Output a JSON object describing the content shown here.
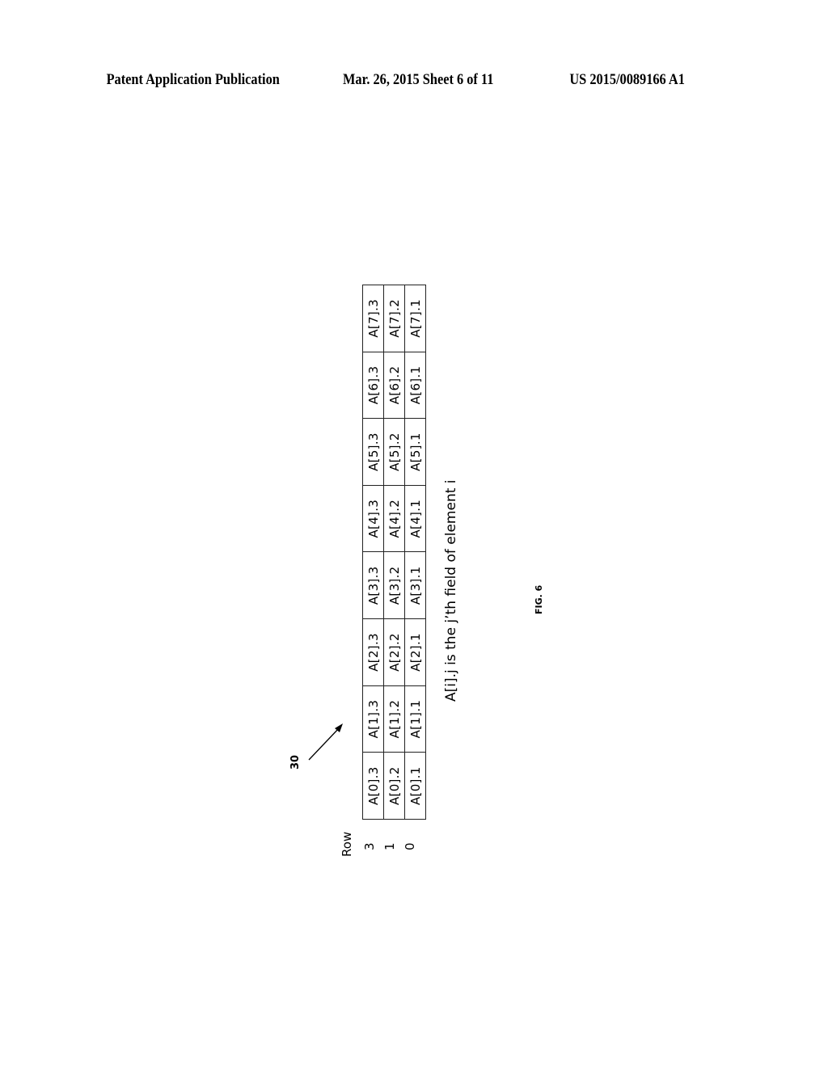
{
  "header": {
    "publication": "Patent Application Publication",
    "date_sheet": "Mar. 26, 2015  Sheet 6 of 11",
    "patent_number": "US 2015/0089166 A1"
  },
  "figure": {
    "reference_numeral": "30",
    "row_label_title": "Row",
    "rows": [
      {
        "label": "3",
        "cells": [
          "A[0].3",
          "A[1].3",
          "A[2].3",
          "A[3].3",
          "A[4].3",
          "A[5].3",
          "A[6].3",
          "A[7].3"
        ]
      },
      {
        "label": "1",
        "cells": [
          "A[0].2",
          "A[1].2",
          "A[2].2",
          "A[3].2",
          "A[4].2",
          "A[5].2",
          "A[6].2",
          "A[7].2"
        ]
      },
      {
        "label": "0",
        "cells": [
          "A[0].1",
          "A[1].1",
          "A[2].1",
          "A[3].1",
          "A[4].1",
          "A[5].1",
          "A[6].1",
          "A[7].1"
        ]
      }
    ],
    "caption": "A[i].j is the j’th field of element i",
    "fig_label": "FIG. 6"
  }
}
